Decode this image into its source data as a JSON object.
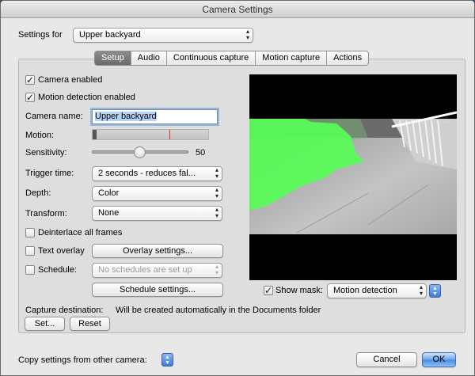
{
  "window": {
    "title": "Camera Settings"
  },
  "settings_for": {
    "label": "Settings for",
    "value": "Upper backyard"
  },
  "tabs": [
    {
      "label": "Setup",
      "active": true
    },
    {
      "label": "Audio",
      "active": false
    },
    {
      "label": "Continuous capture",
      "active": false
    },
    {
      "label": "Motion capture",
      "active": false
    },
    {
      "label": "Actions",
      "active": false
    }
  ],
  "setup": {
    "camera_enabled": {
      "label": "Camera enabled",
      "checked": true
    },
    "motion_detection": {
      "label": "Motion detection enabled",
      "checked": true
    },
    "camera_name": {
      "label": "Camera name:",
      "value": "Upper backyard"
    },
    "motion": {
      "label": "Motion:"
    },
    "sensitivity": {
      "label": "Sensitivity:",
      "value": "50"
    },
    "trigger_time": {
      "label": "Trigger time:",
      "value": "2 seconds - reduces fal..."
    },
    "depth": {
      "label": "Depth:",
      "value": "Color"
    },
    "transform": {
      "label": "Transform:",
      "value": "None"
    },
    "deinterlace": {
      "label": "Deinterlace all frames",
      "checked": false
    },
    "text_overlay": {
      "label": "Text overlay",
      "checked": false,
      "button": "Overlay settings..."
    },
    "schedule": {
      "label": "Schedule:",
      "checked": false,
      "value": "No schedules are set up"
    },
    "schedule_settings_button": "Schedule settings..."
  },
  "preview": {
    "show_mask": {
      "label": "Show mask:",
      "checked": true,
      "value": "Motion detection"
    },
    "mask_color": "#55ff55"
  },
  "capture": {
    "label": "Capture destination:",
    "value": "Will be created automatically in the Documents folder",
    "set_button": "Set...",
    "reset_button": "Reset"
  },
  "footer": {
    "copy_label": "Copy settings from other camera:",
    "cancel_button": "Cancel",
    "ok_button": "OK"
  }
}
